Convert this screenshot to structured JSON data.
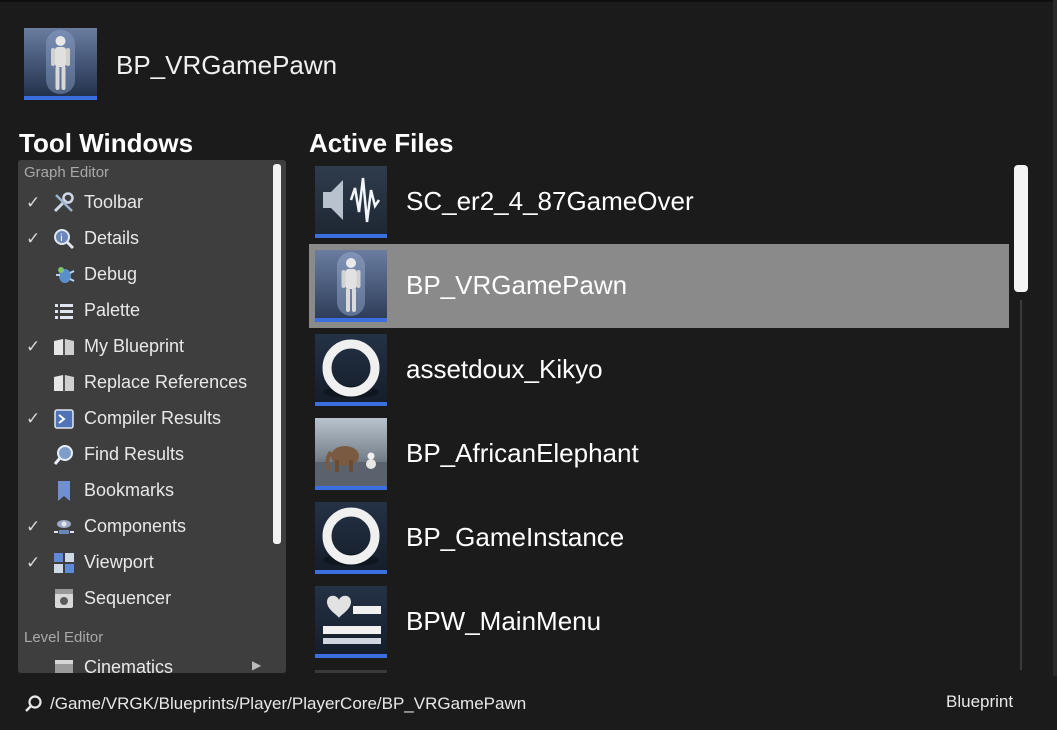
{
  "header": {
    "asset_name": "BP_VRGamePawn",
    "thumbnail_icon": "mannequin-icon"
  },
  "tool_windows": {
    "title": "Tool Windows",
    "groups": [
      {
        "label": "Graph Editor",
        "items": [
          {
            "label": "Toolbar",
            "checked": true,
            "icon": "wrench-icon"
          },
          {
            "label": "Details",
            "checked": true,
            "icon": "details-magnifier-icon"
          },
          {
            "label": "Debug",
            "checked": false,
            "icon": "debug-bug-icon"
          },
          {
            "label": "Palette",
            "checked": false,
            "icon": "palette-list-icon"
          },
          {
            "label": "My Blueprint",
            "checked": true,
            "icon": "book-icon"
          },
          {
            "label": "Replace References",
            "checked": false,
            "icon": "book-icon"
          },
          {
            "label": "Compiler Results",
            "checked": true,
            "icon": "compiler-icon"
          },
          {
            "label": "Find Results",
            "checked": false,
            "icon": "find-magnifier-icon"
          },
          {
            "label": "Bookmarks",
            "checked": false,
            "icon": "bookmark-icon"
          },
          {
            "label": "Components",
            "checked": true,
            "icon": "components-icon"
          },
          {
            "label": "Viewport",
            "checked": true,
            "icon": "viewport-icon"
          },
          {
            "label": "Sequencer",
            "checked": false,
            "icon": "sequencer-icon"
          }
        ]
      },
      {
        "label": "Level Editor",
        "items": [
          {
            "label": "Cinematics",
            "checked": false,
            "icon": "clapperboard-icon",
            "has_submenu": true
          }
        ]
      }
    ]
  },
  "active_files": {
    "title": "Active Files",
    "items": [
      {
        "name": "SC_er2_4_87GameOver",
        "thumb": "sound-wave-thumb",
        "selected": false
      },
      {
        "name": "BP_VRGamePawn",
        "thumb": "mannequin-thumb",
        "selected": true
      },
      {
        "name": "assetdoux_Kikyo",
        "thumb": "ring-thumb",
        "selected": false
      },
      {
        "name": "BP_AfricanElephant",
        "thumb": "elephant-scene-thumb",
        "selected": false
      },
      {
        "name": "BP_GameInstance",
        "thumb": "ring-thumb",
        "selected": false
      },
      {
        "name": "BPW_MainMenu",
        "thumb": "widget-heart-thumb",
        "selected": false
      }
    ]
  },
  "footer": {
    "path": "/Game/VRGK/Blueprints/Player/PlayerCore/BP_VRGamePawn",
    "asset_type": "Blueprint"
  },
  "colors": {
    "accent": "#3b6fe0",
    "selected_row": "#8a8a8a",
    "panel": "#3e3e3e",
    "background": "#1b1b1b"
  }
}
